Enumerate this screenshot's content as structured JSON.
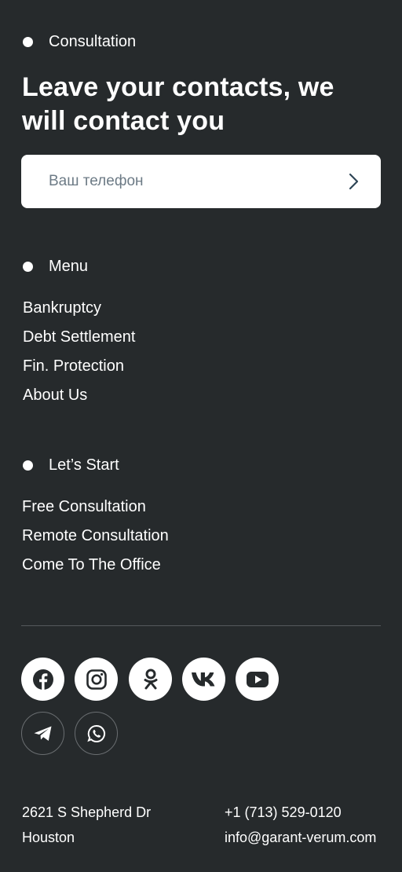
{
  "consultation": {
    "label": "Consultation",
    "headline": "Leave your contacts, we will contact you",
    "phone_placeholder": "Ваш телефон"
  },
  "menu": {
    "label": "Menu",
    "items": [
      "Bankruptcy",
      "Debt Settlement",
      "Fin. Protection",
      "About Us"
    ]
  },
  "start": {
    "label": "Let’s Start",
    "items": [
      "Free Consultation",
      "Remote Consultation",
      "Come To The Office"
    ]
  },
  "social": {
    "icons": [
      "facebook-icon",
      "instagram-icon",
      "odnoklassniki-icon",
      "vk-icon",
      "youtube-icon",
      "telegram-icon",
      "whatsapp-icon"
    ]
  },
  "footer": {
    "address_line1": "2621 S Shepherd Dr",
    "address_line2": "Houston",
    "phone": "+1 (713) 529-0120",
    "email": "info@garant-verum.com"
  },
  "colors": {
    "background": "#262a2c",
    "text": "#ffffff",
    "divider": "#55595c",
    "icon_dark": "#262a2c"
  }
}
